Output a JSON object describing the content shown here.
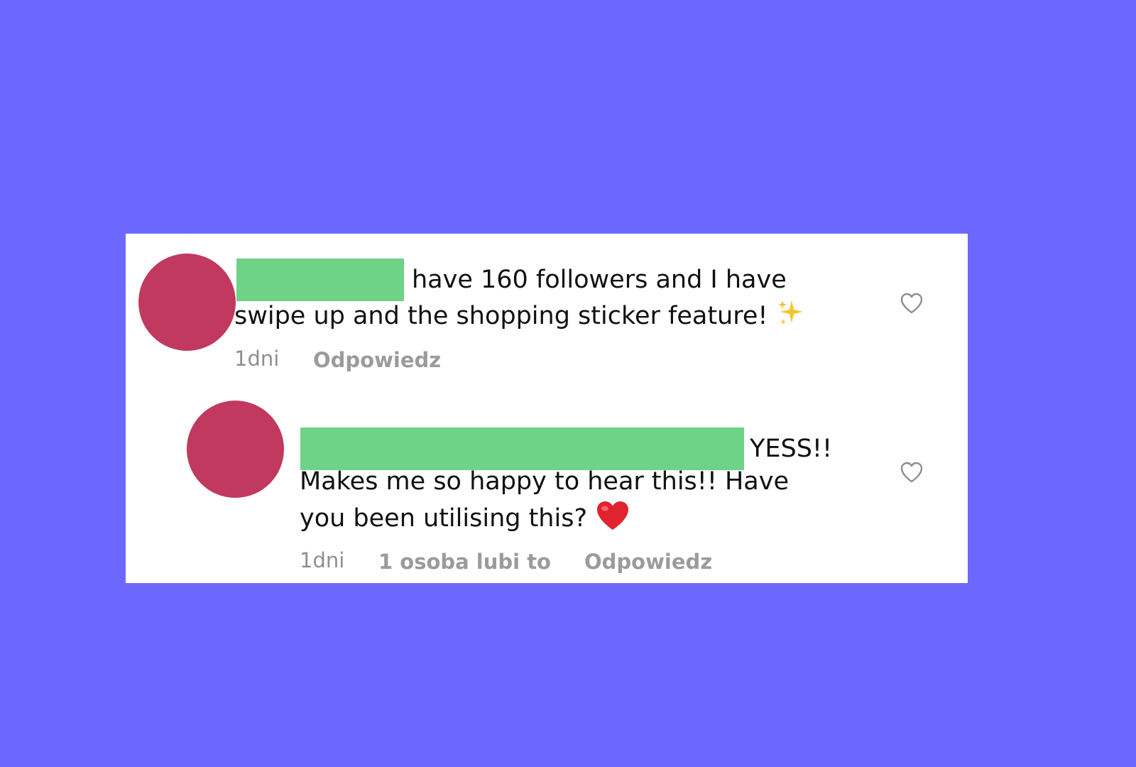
{
  "comments": [
    {
      "line1": "have 160 followers and I have",
      "line2": "swipe up and the shopping sticker feature!",
      "emoji": "sparkles-icon",
      "time": "1dni",
      "reply_label": "Odpowiedz",
      "liked": false
    },
    {
      "line1": "YESS!!",
      "line2": "Makes me so happy to hear this!! Have",
      "line3": "you been utilising this?",
      "emoji": "red-heart-icon",
      "time": "1dni",
      "likes_label": "1 osoba lubi to",
      "reply_label": "Odpowiedz",
      "liked": false
    }
  ],
  "colors": {
    "background": "#6c68ff",
    "card": "#ffffff",
    "avatar": "#c1395e",
    "redaction": "#6ed287",
    "meta_text": "#9b9b9b"
  }
}
